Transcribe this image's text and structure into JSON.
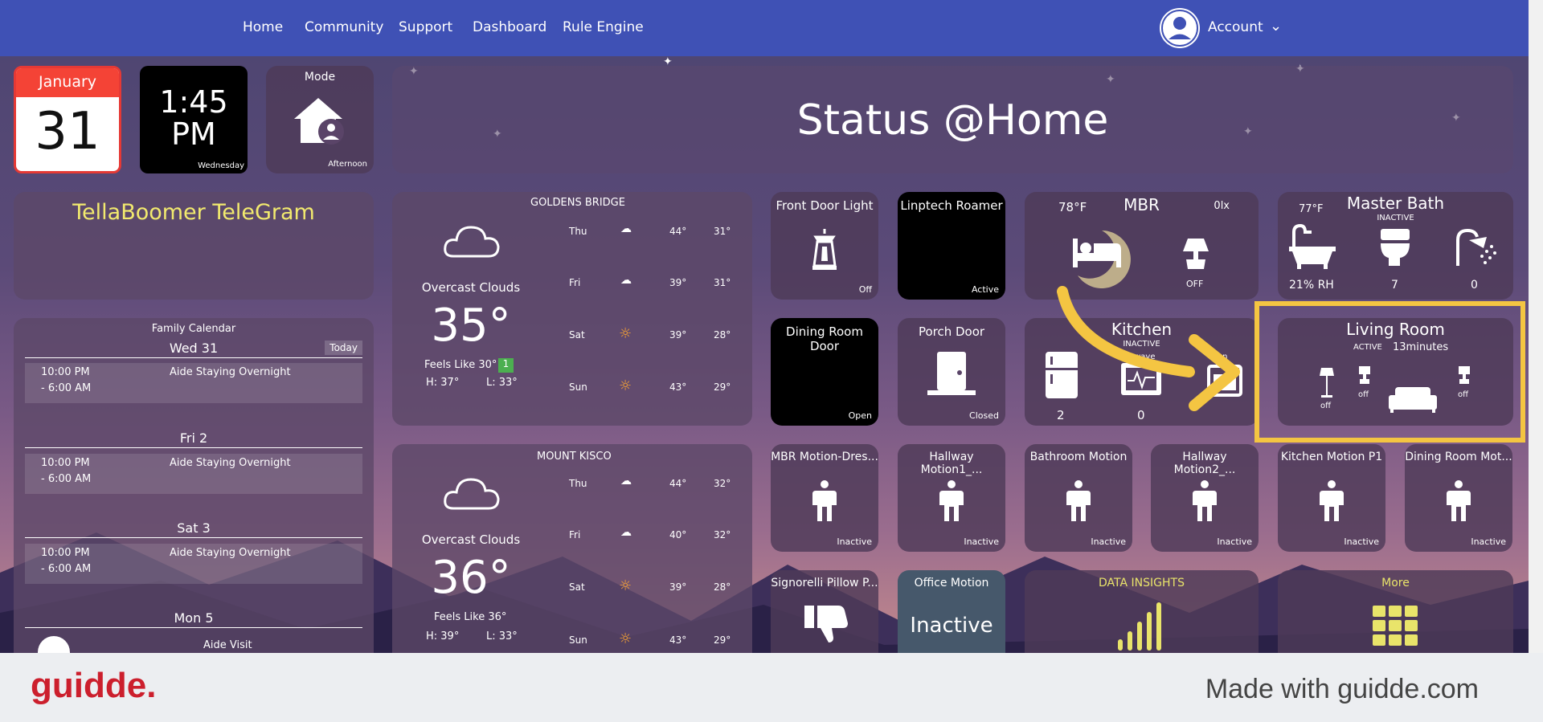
{
  "nav": {
    "items": [
      "Home",
      "Community",
      "Support",
      "Dashboard",
      "Rule Engine"
    ],
    "account": "Account"
  },
  "date_tile": {
    "month": "January",
    "day": "31"
  },
  "clock_tile": {
    "time_line1": "1:45",
    "time_line2": "PM",
    "weekday": "Wednesday"
  },
  "mode_tile": {
    "title": "Mode",
    "value": "Afternoon"
  },
  "banner": {
    "title": "Status @Home"
  },
  "telegram": {
    "title": "TellaBoomer TeleGram"
  },
  "calendar": {
    "title": "Family Calendar",
    "today_badge": "Today",
    "days": [
      {
        "label": "Wed 31",
        "events": [
          {
            "time1": "10:00 PM",
            "time2": "- 6:00 AM",
            "text": "Aide Staying Overnight"
          }
        ]
      },
      {
        "label": "Fri 2",
        "events": [
          {
            "time1": "10:00 PM",
            "time2": "- 6:00 AM",
            "text": "Aide Staying Overnight"
          }
        ]
      },
      {
        "label": "Sat 3",
        "events": [
          {
            "time1": "10:00 PM",
            "time2": "- 6:00 AM",
            "text": "Aide Staying Overnight"
          }
        ]
      },
      {
        "label": "Mon 5",
        "events": [
          {
            "text": "Aide Visit"
          }
        ]
      }
    ]
  },
  "weather": [
    {
      "location": "GOLDENS BRIDGE",
      "condition": "Overcast Clouds",
      "temp": "35°",
      "feels": "Feels Like 30°",
      "feels_badge": "1",
      "high": "H: 37°",
      "low": "L: 33°",
      "forecast": [
        {
          "day": "Thu",
          "icon": "cloud",
          "hi": "44°",
          "lo": "31°"
        },
        {
          "day": "Fri",
          "icon": "cloud",
          "hi": "39°",
          "lo": "31°"
        },
        {
          "day": "Sat",
          "icon": "sun",
          "hi": "39°",
          "lo": "28°"
        },
        {
          "day": "Sun",
          "icon": "sun",
          "hi": "43°",
          "lo": "29°"
        }
      ]
    },
    {
      "location": "MOUNT KISCO",
      "condition": "Overcast Clouds",
      "temp": "36°",
      "feels": "Feels Like 36°",
      "high": "H: 39°",
      "low": "L: 33°",
      "forecast": [
        {
          "day": "Thu",
          "icon": "cloud",
          "hi": "44°",
          "lo": "32°"
        },
        {
          "day": "Fri",
          "icon": "cloud",
          "hi": "40°",
          "lo": "32°"
        },
        {
          "day": "Sat",
          "icon": "sun",
          "hi": "39°",
          "lo": "28°"
        },
        {
          "day": "Sun",
          "icon": "sun",
          "hi": "43°",
          "lo": "29°"
        }
      ]
    }
  ],
  "devices": {
    "front_door_light": {
      "title": "Front Door Light",
      "status": "Off"
    },
    "linptech": {
      "title": "Linptech Roamer",
      "status": "Active"
    },
    "mbr": {
      "title": "MBR",
      "temp": "78°F",
      "lux": "0lx",
      "lamp_status": "OFF"
    },
    "master_bath": {
      "title": "Master Bath",
      "state": "INACTIVE",
      "temp": "77°F",
      "humidity": "21% RH",
      "toilet_count": "7",
      "shower_count": "0"
    },
    "dining_door": {
      "title": "Dining Room Door",
      "status": "Open"
    },
    "porch_door": {
      "title": "Porch Door",
      "status": "Closed"
    },
    "kitchen": {
      "title": "Kitchen",
      "state": "INACTIVE",
      "sub": "owave",
      "sub2": "en",
      "fridge_count": "2",
      "micro_count": "0"
    },
    "living_room": {
      "title": "Living Room",
      "state": "ACTIVE",
      "duration": "13minutes",
      "lamp1": "off",
      "lamp2": "off",
      "lamp3": "off"
    },
    "motions": [
      {
        "title": "MBR Motion-Dres...",
        "status": "Inactive"
      },
      {
        "title": "Hallway Motion1_...",
        "status": "Inactive"
      },
      {
        "title": "Bathroom Motion",
        "status": "Inactive"
      },
      {
        "title": "Hallway Motion2_...",
        "status": "Inactive"
      },
      {
        "title": "Kitchen Motion P1",
        "status": "Inactive"
      },
      {
        "title": "Dining Room Mot...",
        "status": "Inactive"
      }
    ],
    "pillow": {
      "title": "Signorelli Pillow P..."
    },
    "office_motion": {
      "title": "Office Motion",
      "status": "Inactive"
    },
    "insights": {
      "title": "DATA INSIGHTS"
    },
    "more": {
      "title": "More"
    }
  },
  "footer": {
    "logo": "guidde.",
    "credit": "Made with guidde.com"
  },
  "colors": {
    "nav": "#3f51b5",
    "highlight": "#f4c542",
    "accent_yellow": "#e9e46a",
    "badge_green": "#4caf50"
  }
}
